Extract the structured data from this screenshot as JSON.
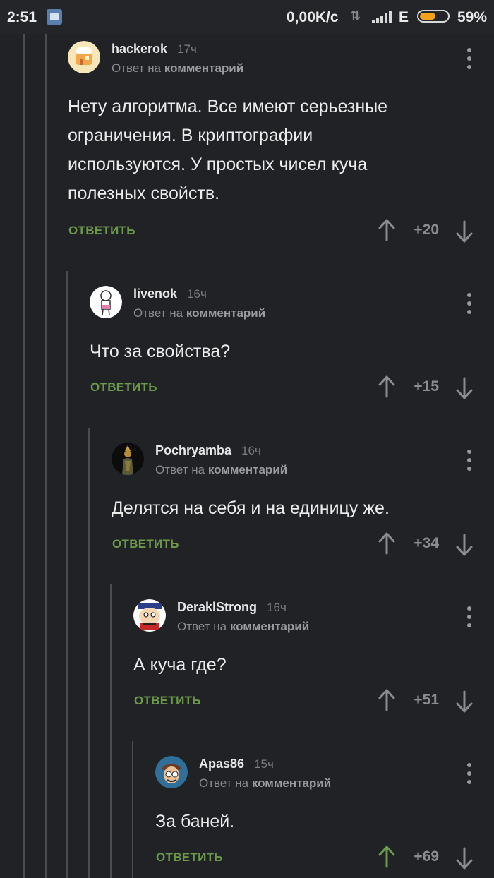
{
  "status_bar": {
    "time": "2:51",
    "speed": "0,00K/c",
    "network": "E",
    "battery_level": 59,
    "battery_label": "59%"
  },
  "reply_prefix": "Ответ на",
  "reply_target": "комментарий",
  "reply_button_label": "ОТВЕТИТЬ",
  "colors": {
    "accent_green": "#6c9a4a",
    "background": "#202226"
  },
  "comments": [
    {
      "author": "hackerok",
      "time": "17ч",
      "text": [
        "Нету алгоритма. Все имеют серьезные",
        "ограничения. В криптографии",
        "используются. У простых чисел куча",
        "полезных свойств."
      ],
      "score": "+20",
      "upvoted": false
    },
    {
      "author": "livenok",
      "time": "16ч",
      "text": [
        "Что за свойства?"
      ],
      "score": "+15",
      "upvoted": false
    },
    {
      "author": "Pochryamba",
      "time": "16ч",
      "text": [
        "Делятся на себя и на единицу же."
      ],
      "score": "+34",
      "upvoted": false
    },
    {
      "author": "DeraklStrong",
      "time": "16ч",
      "text": [
        "А куча где?"
      ],
      "score": "+51",
      "upvoted": false
    },
    {
      "author": "Apas86",
      "time": "15ч",
      "text": [
        "За баней."
      ],
      "score": "+69",
      "upvoted": true
    }
  ]
}
